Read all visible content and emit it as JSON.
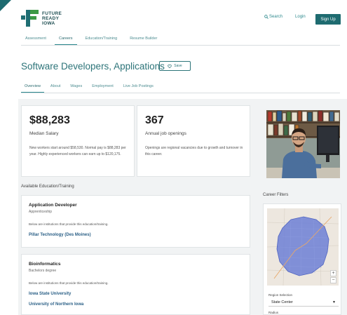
{
  "brand": {
    "line1": "FUTURE",
    "line2": "READY",
    "line3": "IOWA"
  },
  "header": {
    "search_label": "Search",
    "login_label": "Login",
    "signup_label": "Sign Up"
  },
  "main_nav": [
    {
      "label": "Assessment"
    },
    {
      "label": "Careers",
      "active": true
    },
    {
      "label": "Education/Training"
    },
    {
      "label": "Resume Builder"
    }
  ],
  "career": {
    "title": "Software Developers, Applications",
    "save_label": "Save"
  },
  "sub_nav": [
    {
      "label": "Overview",
      "active": true
    },
    {
      "label": "About"
    },
    {
      "label": "Wages"
    },
    {
      "label": "Employment"
    },
    {
      "label": "Live Job Postings"
    }
  ],
  "stats": {
    "salary": {
      "value": "$88,283",
      "label": "Median Salary",
      "description": "New workers start around $58,530. Normal pay is $88,283 per year. Highly experienced workers can earn up to $120,175."
    },
    "openings": {
      "value": "367",
      "label": "Annual job openings",
      "description": "Openings are regional vacancies due to growth and turnover in this career."
    }
  },
  "education": {
    "section_label": "Available Education/Training",
    "items": [
      {
        "title": "Application Developer",
        "type": "Apprenticeship",
        "note": "Below are institutions that provide this education/training.",
        "institutions": [
          "Pillar Technology (Des Moines)"
        ]
      },
      {
        "title": "Bioinformatics",
        "type": "Bachelors degree",
        "note": "Below are institutions that provide this education/training.",
        "institutions": [
          "Iowa State University",
          "University of Northern Iowa"
        ]
      }
    ]
  },
  "filters": {
    "section_label": "Career Filters",
    "region_label": "Region Selection",
    "region_value": "State Center",
    "radius_label": "Radius"
  },
  "colors": {
    "accent": "#1e6b70",
    "link": "#2a5f86",
    "green": "#3d9a45",
    "map_region": "#6c7fd6"
  }
}
